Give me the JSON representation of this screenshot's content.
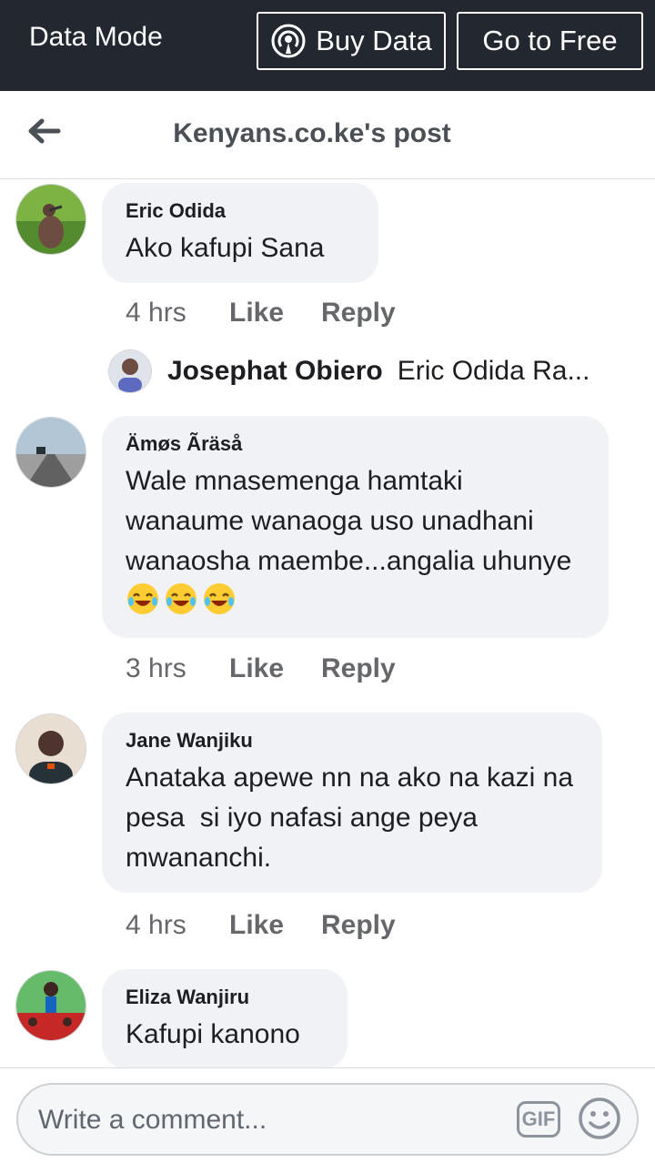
{
  "data_bar": {
    "mode_label": "Data Mode",
    "buy_label": "Buy Data",
    "free_label": "Go to Free",
    "icon": "broadcast-icon"
  },
  "header": {
    "title": "Kenyans.co.ke's post",
    "back_icon": "back-arrow-icon"
  },
  "comments": [
    {
      "author": "Eric Odida",
      "text": "Ako kafupi Sana",
      "time": "4 hrs",
      "like": "Like",
      "reply": "Reply",
      "avatar": "duck-avatar",
      "reply_preview": {
        "author": "Josephat Obiero",
        "text": "Eric Odida Ra..."
      }
    },
    {
      "author": "Ämøs Ãräså",
      "text": "Wale mnasemenga hamtaki wanaume wanaoga uso unadhani wanaosha maembe...angalia uhunye",
      "emojis": [
        "laughing-crying-emoji",
        "laughing-crying-emoji",
        "laughing-crying-emoji"
      ],
      "time": "3 hrs",
      "like": "Like",
      "reply": "Reply",
      "avatar": "road-avatar"
    },
    {
      "author": "Jane Wanjiku",
      "text": "Anataka apewe nn na ako na kazi na pesa  si iyo nafasi ange peya mwananchi.",
      "time": "4 hrs",
      "like": "Like",
      "reply": "Reply",
      "avatar": "person-avatar"
    },
    {
      "author": "Eliza Wanjiru",
      "text": "Kafupi kanono",
      "avatar": "group-avatar"
    }
  ],
  "composer": {
    "placeholder": "Write a comment...",
    "gif_label": "GIF",
    "emoji_icon": "smiley-icon"
  },
  "colors": {
    "data_bar_bg": "#232830",
    "bubble_bg": "#f0f2f5",
    "secondary_text": "#65676b"
  }
}
